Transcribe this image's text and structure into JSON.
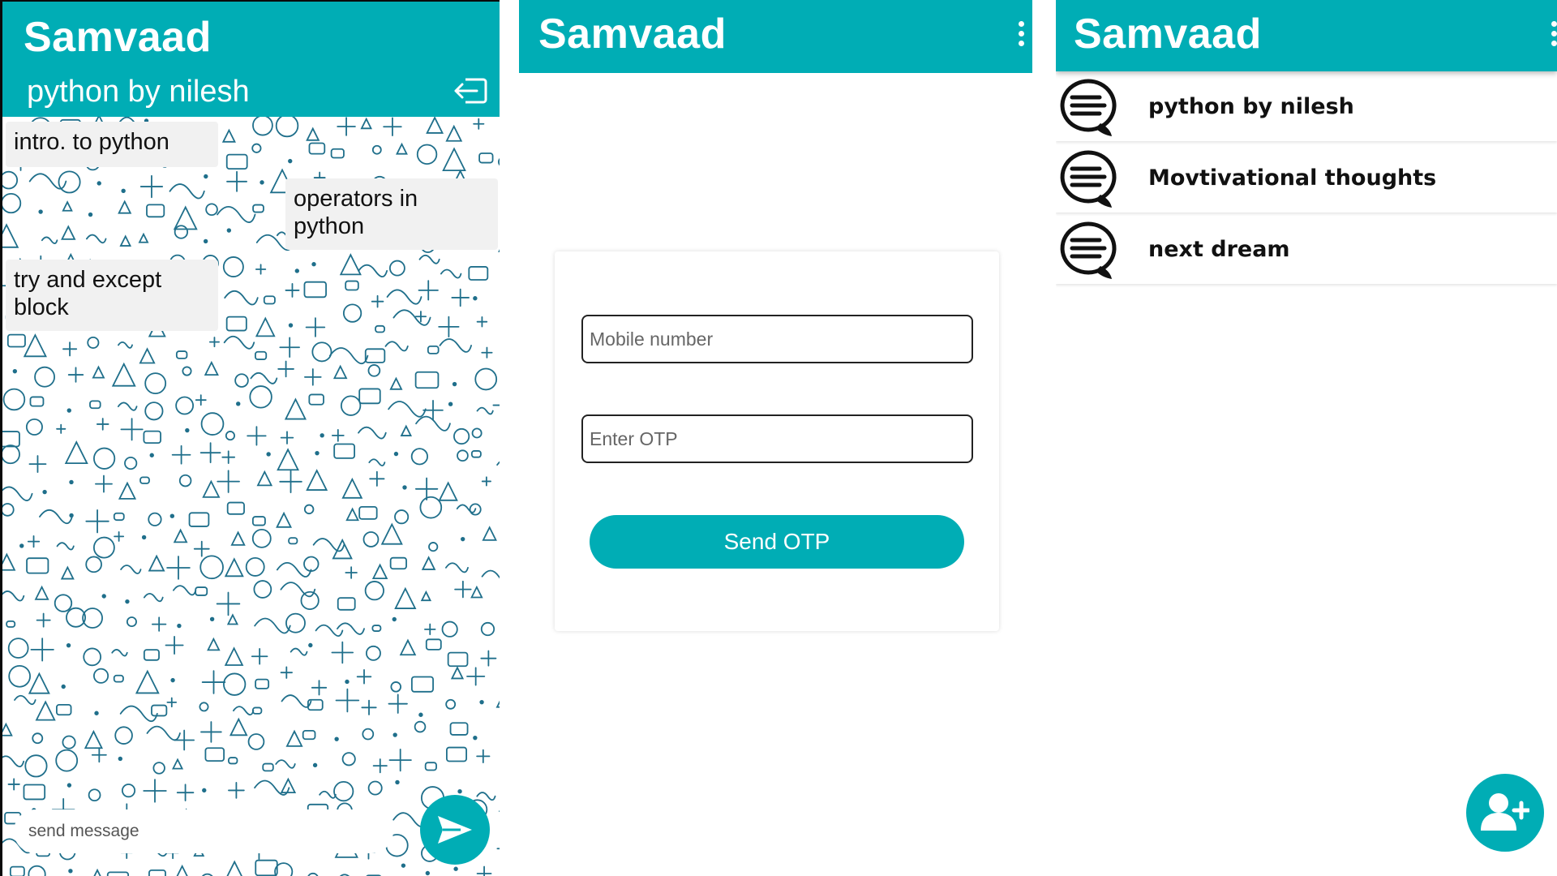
{
  "app": {
    "title": "Samvaad"
  },
  "colors": {
    "accent": "#00adb5",
    "bubble": "#f1f1f1",
    "pattern": "#1f6f8b"
  },
  "chat": {
    "title": "Samvaad",
    "group_name": "python by nilesh",
    "exit_icon": "exit-icon",
    "messages": [
      {
        "text": "intro. to python"
      },
      {
        "text": "operators in python"
      },
      {
        "text": "try and except block"
      }
    ],
    "composer_placeholder": "send message",
    "send_icon": "send-icon"
  },
  "login": {
    "title": "Samvaad",
    "menu_icon": "more-vertical-icon",
    "mobile_placeholder": "Mobile number",
    "otp_placeholder": "Enter OTP",
    "send_otp_label": "Send OTP"
  },
  "groups": {
    "title": "Samvaad",
    "menu_icon": "more-vertical-icon",
    "items": [
      {
        "name": "python by nilesh",
        "icon": "chat-bubble-icon"
      },
      {
        "name": "Movtivational thoughts",
        "icon": "chat-bubble-icon"
      },
      {
        "name": "next dream",
        "icon": "chat-bubble-icon"
      }
    ],
    "fab_icon": "add-user-icon"
  }
}
